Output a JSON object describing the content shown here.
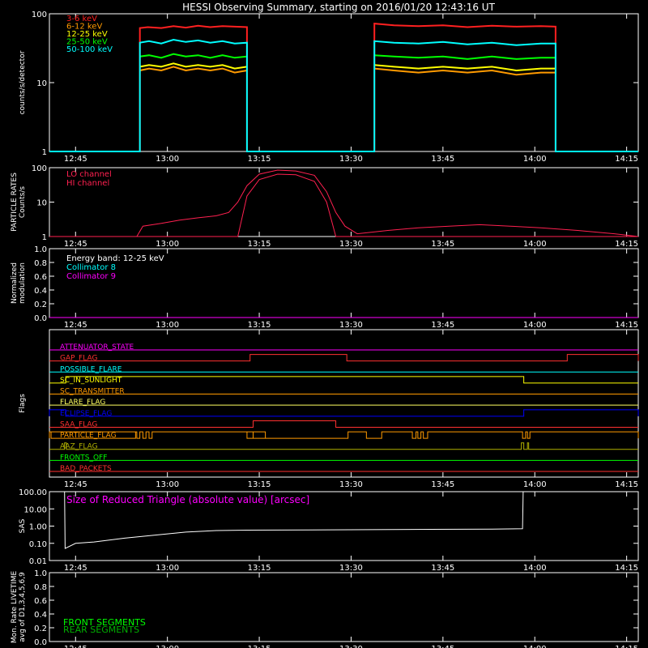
{
  "title": "HESSI Observing Summary, starting on 2016/01/20 12:43:16 UT",
  "colors": {
    "background": "#000000",
    "axes": "#ffffff",
    "e3_6": "#ff2020",
    "e6_12": "#ff9a00",
    "e12_25": "#ffff00",
    "e25_50": "#00ff00",
    "e50_100": "#00ffff",
    "lo_channel": "#ff2050",
    "hi_channel": "#ff2050",
    "collimator8": "#00ffff",
    "collimator9": "#ff00ff",
    "sas": "#ff00ff",
    "front": "#00ff00",
    "rear": "#00b000"
  },
  "time_axis": {
    "ticks": [
      "12:45",
      "13:00",
      "13:15",
      "13:30",
      "13:45",
      "14:00",
      "14:15"
    ]
  },
  "chart_data": [
    {
      "type": "line",
      "id": "counts",
      "ylabel": "counts/s/detector",
      "yscale": "log",
      "ylim": [
        1,
        100
      ],
      "yticks": [
        "1",
        "10",
        "100"
      ],
      "x_range_minutes": [
        -2.27,
        93.9
      ],
      "legend_placement": "top-left",
      "series": [
        {
          "name": "3-6 keV",
          "color_key": "e3_6",
          "segments": [
            [
              [
                -2.27,
                1
              ],
              [
                12.5,
                1
              ],
              [
                12.5,
                62
              ],
              [
                13.8,
                64
              ],
              [
                16,
                62
              ],
              [
                18,
                66
              ],
              [
                20,
                63
              ],
              [
                22,
                67
              ],
              [
                24,
                64
              ],
              [
                26,
                66
              ],
              [
                28,
                65
              ],
              [
                30.0,
                64
              ],
              [
                30.0,
                1
              ],
              [
                50.8,
                1
              ],
              [
                50.8,
                72
              ],
              [
                54,
                68
              ],
              [
                58,
                66
              ],
              [
                62,
                68
              ],
              [
                66,
                64
              ],
              [
                70,
                67
              ],
              [
                74,
                65
              ],
              [
                78,
                66
              ],
              [
                80.4,
                65
              ],
              [
                80.4,
                1
              ],
              [
                93.9,
                1
              ]
            ]
          ]
        },
        {
          "name": "6-12 keV",
          "color_key": "e6_12",
          "segments": [
            [
              [
                12.5,
                15
              ],
              [
                14,
                16
              ],
              [
                16,
                15
              ],
              [
                18,
                17
              ],
              [
                20,
                15
              ],
              [
                22,
                16
              ],
              [
                24,
                15
              ],
              [
                26,
                16
              ],
              [
                28,
                14
              ],
              [
                30.0,
                15
              ]
            ],
            [
              [
                50.8,
                16
              ],
              [
                54,
                15
              ],
              [
                58,
                14
              ],
              [
                62,
                15
              ],
              [
                66,
                14
              ],
              [
                70,
                15
              ],
              [
                74,
                13
              ],
              [
                78,
                14
              ],
              [
                80.4,
                14
              ]
            ]
          ]
        },
        {
          "name": "12-25 keV",
          "color_key": "e12_25",
          "segments": [
            [
              [
                12.5,
                17
              ],
              [
                14,
                18
              ],
              [
                16,
                17
              ],
              [
                18,
                19
              ],
              [
                20,
                17
              ],
              [
                22,
                18
              ],
              [
                24,
                17
              ],
              [
                26,
                18
              ],
              [
                28,
                16
              ],
              [
                30.0,
                17
              ]
            ],
            [
              [
                50.8,
                18
              ],
              [
                54,
                17
              ],
              [
                58,
                16
              ],
              [
                62,
                17
              ],
              [
                66,
                16
              ],
              [
                70,
                17
              ],
              [
                74,
                15
              ],
              [
                78,
                16
              ],
              [
                80.4,
                16
              ]
            ]
          ]
        },
        {
          "name": "25-50 keV",
          "color_key": "e25_50",
          "segments": [
            [
              [
                12.5,
                24
              ],
              [
                14,
                25
              ],
              [
                16,
                23
              ],
              [
                18,
                26
              ],
              [
                20,
                24
              ],
              [
                22,
                25
              ],
              [
                24,
                23
              ],
              [
                26,
                25
              ],
              [
                28,
                23
              ],
              [
                30.0,
                24
              ]
            ],
            [
              [
                50.8,
                25
              ],
              [
                54,
                24
              ],
              [
                58,
                23
              ],
              [
                62,
                24
              ],
              [
                66,
                22
              ],
              [
                70,
                24
              ],
              [
                74,
                22
              ],
              [
                78,
                23
              ],
              [
                80.4,
                23
              ]
            ]
          ]
        },
        {
          "name": "50-100 keV",
          "color_key": "e50_100",
          "segments": [
            [
              [
                -2.27,
                1
              ],
              [
                12.5,
                1
              ],
              [
                12.5,
                38
              ],
              [
                14,
                40
              ],
              [
                16,
                37
              ],
              [
                18,
                42
              ],
              [
                20,
                39
              ],
              [
                22,
                41
              ],
              [
                24,
                38
              ],
              [
                26,
                40
              ],
              [
                28,
                37
              ],
              [
                30.0,
                38
              ],
              [
                30.0,
                1
              ],
              [
                50.8,
                1
              ],
              [
                50.8,
                40
              ],
              [
                54,
                38
              ],
              [
                58,
                37
              ],
              [
                62,
                39
              ],
              [
                66,
                36
              ],
              [
                70,
                38
              ],
              [
                74,
                35
              ],
              [
                78,
                37
              ],
              [
                80.4,
                37
              ],
              [
                80.4,
                1
              ],
              [
                93.9,
                1
              ]
            ]
          ]
        }
      ]
    },
    {
      "type": "line",
      "id": "particle",
      "ylabel": "PARTICLE RATES",
      "ylabel2": "Counts/s",
      "yscale": "log",
      "ylim": [
        1,
        100
      ],
      "yticks": [
        "1",
        "10",
        "100"
      ],
      "legend_placement": "top-left",
      "series": [
        {
          "name": "LO channel",
          "color_key": "lo_channel",
          "points": [
            [
              -2.27,
              1
            ],
            [
              12,
              1
            ],
            [
              13,
              2
            ],
            [
              16,
              2.4
            ],
            [
              19,
              3
            ],
            [
              22,
              3.5
            ],
            [
              25,
              4
            ],
            [
              27,
              5
            ],
            [
              28.5,
              10
            ],
            [
              30,
              30
            ],
            [
              32,
              65
            ],
            [
              35,
              85
            ],
            [
              38,
              80
            ],
            [
              41,
              60
            ],
            [
              43,
              20
            ],
            [
              44.5,
              5
            ],
            [
              46,
              2
            ],
            [
              48,
              1.2
            ],
            [
              53,
              1.5
            ],
            [
              58,
              1.8
            ],
            [
              63,
              2
            ],
            [
              68,
              2.2
            ],
            [
              73,
              2
            ],
            [
              78,
              1.8
            ],
            [
              84,
              1.5
            ],
            [
              90,
              1.2
            ],
            [
              93.9,
              1
            ]
          ]
        },
        {
          "name": "HI channel",
          "color_key": "hi_channel",
          "points": [
            [
              -2.27,
              1
            ],
            [
              28.5,
              1
            ],
            [
              30,
              15
            ],
            [
              32,
              45
            ],
            [
              35,
              65
            ],
            [
              38,
              62
            ],
            [
              41,
              40
            ],
            [
              43,
              10
            ],
            [
              44.5,
              1
            ],
            [
              93.9,
              1
            ]
          ]
        }
      ]
    },
    {
      "type": "line",
      "id": "modulation",
      "ylabel": "Normalized",
      "ylabel2": "modulation",
      "ylim": [
        0,
        1
      ],
      "yticks": [
        "0.0",
        "0.2",
        "0.4",
        "0.6",
        "0.8",
        "1.0"
      ],
      "annotation": "Energy band: 12-25 keV",
      "legend_placement": "top-left",
      "series": [
        {
          "name": "Collimator 8",
          "color_key": "collimator8",
          "points": [
            [
              -2.27,
              0
            ],
            [
              93.9,
              0
            ]
          ]
        },
        {
          "name": "Collimator 9",
          "color_key": "collimator9",
          "points": [
            [
              -2.27,
              0
            ],
            [
              93.9,
              0
            ]
          ]
        }
      ]
    },
    {
      "type": "line",
      "id": "flags",
      "ylabel": "Flags",
      "series": [
        {
          "name": "ATTENUATOR_STATE",
          "color": "#ff00ff",
          "steps": []
        },
        {
          "name": "GAP_FLAG",
          "color": "#ff3030",
          "steps": [
            [
              30.5,
              46.3
            ],
            [
              82.3,
              93.9
            ]
          ]
        },
        {
          "name": "POSSIBLE_FLARE",
          "color": "#00ffff",
          "steps": []
        },
        {
          "name": "SC_IN_SUNLIGHT",
          "color": "#ffff00",
          "steps": [
            [
              0.4,
              75.2
            ]
          ]
        },
        {
          "name": "SC_TRANSMITTER",
          "color": "#ff9a00",
          "steps": []
        },
        {
          "name": "FLARE_FLAG",
          "color": "#ffff60",
          "steps": []
        },
        {
          "name": "ECLIPSE_FLAG",
          "color": "#0000ff",
          "steps": [
            [
              -2.27,
              0.4
            ],
            [
              75.2,
              93.9
            ]
          ]
        },
        {
          "name": "SAA_FLAG",
          "color": "#ff3030",
          "steps": [
            [
              31,
              44.5
            ]
          ]
        },
        {
          "name": "PARTICLE_FLAG",
          "color": "#ff9a00",
          "steps": [
            [
              -2.27,
              11.8
            ],
            [
              -2,
              12
            ],
            [
              12.5,
              13
            ],
            [
              13.5,
              14
            ],
            [
              14.5,
              33
            ],
            [
              30,
              31
            ],
            [
              46.5,
              49.5
            ],
            [
              52,
              57
            ],
            [
              57.6,
              57.9
            ],
            [
              58.4,
              58.8
            ],
            [
              59.5,
              75
            ],
            [
              75.5,
              75.8
            ],
            [
              76.2,
              93.9
            ]
          ]
        },
        {
          "name": "AAZ_FLAG",
          "color": "#b0b000",
          "steps": [
            [
              0.2,
              0.5
            ],
            [
              74.8,
              75.2
            ],
            [
              75.8,
              76
            ]
          ]
        },
        {
          "name": "FRONTS_OFF",
          "color": "#00ff00",
          "steps": []
        },
        {
          "name": "BAD_PACKETS",
          "color": "#ff3030",
          "steps": []
        }
      ]
    },
    {
      "type": "line",
      "id": "sas",
      "ylabel": "SAS",
      "yscale": "log",
      "ylim": [
        0.01,
        100
      ],
      "yticks": [
        "0.01",
        "0.10",
        "1.00",
        "10.00",
        "100.00"
      ],
      "annotation": "Size of Reduced Triangle (absolute value) [arcsec]",
      "series": [
        {
          "name": "",
          "color_key": "axes",
          "points": [
            [
              0.2,
              100
            ],
            [
              0.3,
              0.05
            ],
            [
              2,
              0.1
            ],
            [
              5,
              0.12
            ],
            [
              10,
              0.2
            ],
            [
              15,
              0.3
            ],
            [
              20,
              0.45
            ],
            [
              25,
              0.55
            ],
            [
              30,
              0.58
            ],
            [
              40,
              0.6
            ],
            [
              50,
              0.62
            ],
            [
              60,
              0.65
            ],
            [
              70,
              0.66
            ],
            [
              75,
              0.7
            ],
            [
              75.1,
              100
            ]
          ]
        }
      ]
    },
    {
      "type": "line",
      "id": "livetime",
      "ylabel": "Mon. Rate LIVETIME",
      "ylabel2": "avg of D1,3,4,5,6,9",
      "ylim": [
        0,
        1
      ],
      "yticks": [
        "0.0",
        "0.2",
        "0.4",
        "0.6",
        "0.8",
        "1.0"
      ],
      "legend_placement": "bottom-left",
      "series": [
        {
          "name": "FRONT SEGMENTS",
          "color_key": "front",
          "points": []
        },
        {
          "name": "REAR SEGMENTS",
          "color_key": "rear",
          "points": []
        }
      ]
    }
  ]
}
